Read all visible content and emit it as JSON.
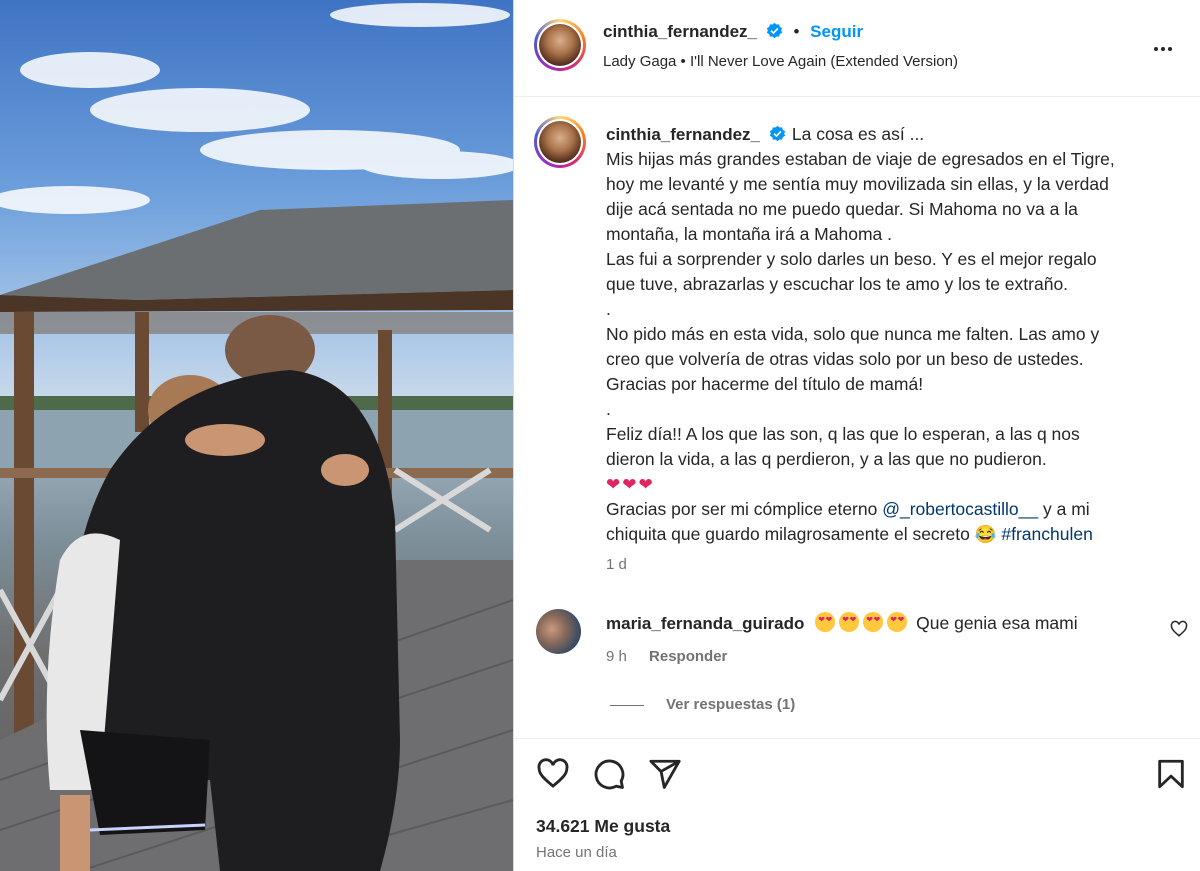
{
  "post": {
    "author": "cinthia_fernandez_",
    "follow_label": "Seguir",
    "separator": "•",
    "music": "Lady Gaga • I'll Never Love Again (Extended Version)",
    "caption_lines": [
      "La cosa es así ...",
      "Mis hijas más grandes estaban de viaje de egresados en el Tigre,",
      "hoy me levanté y me sentía muy movilizada sin ellas, y la verdad",
      "dije acá sentada no me puedo quedar. Si Mahoma no va a la",
      "montaña, la montaña irá a Mahoma .",
      "Las fui a sorprender y solo darles un beso. Y es el mejor regalo",
      "que tuve, abrazarlas y escuchar los te amo y los te extraño.",
      ".",
      "No pido más en esta vida, solo que nunca me falten. Las amo y",
      "creo que volvería de otras vidas solo por un beso de ustedes.",
      "Gracias por hacerme del título de mamá!",
      ".",
      "Feliz día!! A los que las son, q las que lo esperan, a las q nos",
      "dieron la vida, a las q perdieron, y a las que no pudieron."
    ],
    "hearts": "❤❤❤",
    "thanks_prefix": "Gracias por ser mi cómplice eterno ",
    "mention": "@_robertocastillo__",
    "thanks_suffix": " y a mi",
    "last_line": "chiquita que guardo milagrosamente el secreto 😂 ",
    "hashtag": "#franchulen",
    "time": "1 d",
    "likes": "34.621 Me gusta",
    "posted": "Hace un día"
  },
  "comment": {
    "author": "maria_fernanda_guirado",
    "text": "Que genia esa mami",
    "time": "9 h",
    "reply_label": "Responder",
    "view_replies": "Ver respuestas (1)"
  },
  "icons": {
    "like": "heart-icon",
    "comment": "comment-icon",
    "share": "share-icon",
    "save": "bookmark-icon",
    "more": "more-options-icon"
  },
  "colors": {
    "link": "#0095f6",
    "tag": "#00376b",
    "muted": "#737373",
    "verified": "#0095f6"
  }
}
